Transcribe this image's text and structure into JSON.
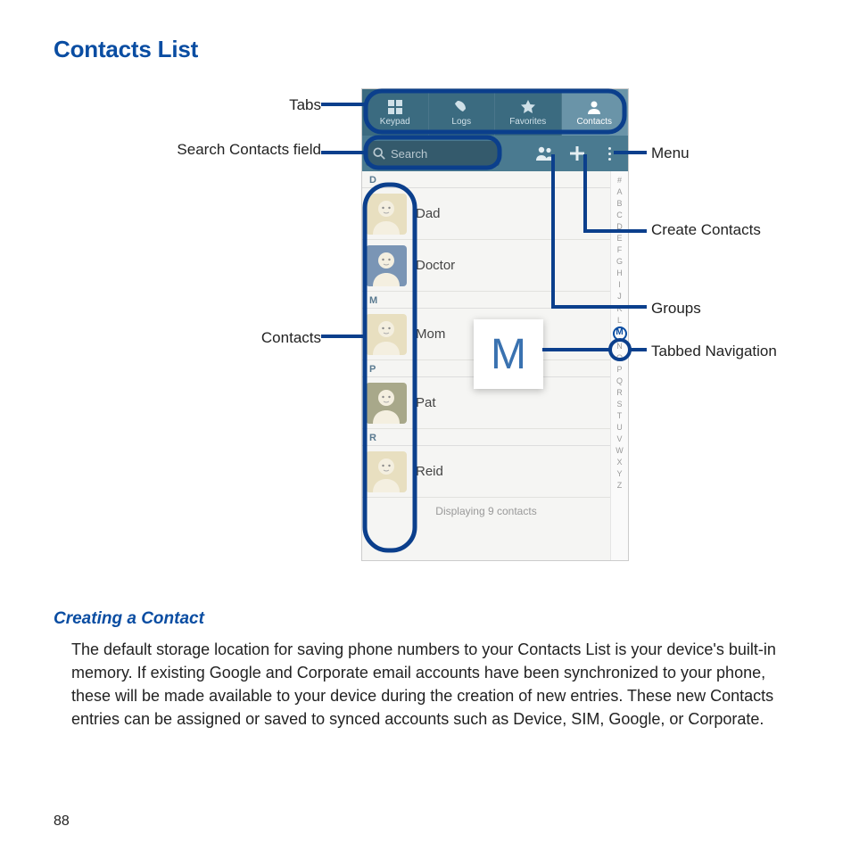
{
  "title": "Contacts List",
  "subtitle": "Creating a Contact",
  "body": "The default storage location for saving phone numbers to your Contacts List is your device's built-in memory. If existing Google and Corporate email accounts have been synchronized to your phone, these will be made available to your device during the creation of new entries. These new Contacts entries can be assigned or saved to synced accounts such as Device, SIM, Google, or Corporate.",
  "page_number": "88",
  "callouts": {
    "tabs": "Tabs",
    "search": "Search Contacts field",
    "contacts": "Contacts",
    "menu": "Menu",
    "create": "Create Contacts",
    "groups": "Groups",
    "tabbed_nav": "Tabbed Navigation"
  },
  "phone": {
    "tabs": [
      {
        "label": "Keypad",
        "icon": "keypad-icon"
      },
      {
        "label": "Logs",
        "icon": "logs-icon"
      },
      {
        "label": "Favorites",
        "icon": "favorites-icon"
      },
      {
        "label": "Contacts",
        "icon": "contacts-icon"
      }
    ],
    "search_placeholder": "Search",
    "sections": [
      {
        "letter": "D",
        "rows": [
          {
            "name": "Dad",
            "avatar_color": "#e8dfc0"
          },
          {
            "name": "Doctor",
            "avatar_color": "#7a95b5"
          }
        ]
      },
      {
        "letter": "M",
        "rows": [
          {
            "name": "Mom",
            "avatar_color": "#e8dfc0"
          }
        ]
      },
      {
        "letter": "P",
        "rows": [
          {
            "name": "Pat",
            "avatar_color": "#a8a88a"
          }
        ]
      },
      {
        "letter": "R",
        "rows": [
          {
            "name": "Reid",
            "avatar_color": "#e8dfc0"
          }
        ]
      }
    ],
    "popup_letter": "M",
    "footer": "Displaying 9 contacts",
    "index_rail": [
      "#",
      "A",
      "B",
      "C",
      "D",
      "E",
      "F",
      "G",
      "H",
      "I",
      "J",
      "K",
      "L",
      "M",
      "N",
      "O",
      "P",
      "Q",
      "R",
      "S",
      "T",
      "U",
      "V",
      "W",
      "X",
      "Y",
      "Z"
    ],
    "index_active": "M"
  }
}
